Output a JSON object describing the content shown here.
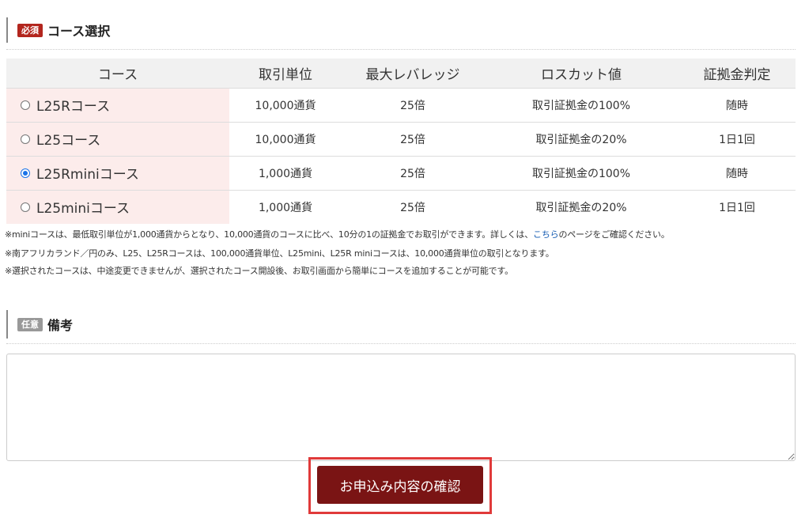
{
  "course_section": {
    "badge": "必須",
    "title": "コース選択",
    "headers": [
      "コース",
      "取引単位",
      "最大レバレッジ",
      "ロスカット値",
      "証拠金判定"
    ],
    "rows": [
      {
        "course": "L25Rコース",
        "unit": "10,000通貨",
        "leverage": "25倍",
        "losscut": "取引証拠金の100%",
        "margin_check": "随時",
        "selected": false
      },
      {
        "course": "L25コース",
        "unit": "10,000通貨",
        "leverage": "25倍",
        "losscut": "取引証拠金の20%",
        "margin_check": "1日1回",
        "selected": false
      },
      {
        "course": "L25Rminiコース",
        "unit": "1,000通貨",
        "leverage": "25倍",
        "losscut": "取引証拠金の100%",
        "margin_check": "随時",
        "selected": true
      },
      {
        "course": "L25miniコース",
        "unit": "1,000通貨",
        "leverage": "25倍",
        "losscut": "取引証拠金の20%",
        "margin_check": "1日1回",
        "selected": false
      }
    ]
  },
  "notes": {
    "line1_before": "※miniコースは、最低取引単位が1,000通貨からとなり、10,000通貨のコースに比べ、10分の1の証拠金でお取引ができます。詳しくは、",
    "line1_link": "こちら",
    "line1_after": "のページをご確認ください。",
    "line2": "※南アフリカランド／円のみ、L25、L25Rコースは、100,000通貨単位、L25mini、L25R miniコースは、10,000通貨単位の取引となります。",
    "line3": "※選択されたコースは、中途変更できませんが、選択されたコース開設後、お取引画面から簡単にコースを追加することが可能です。"
  },
  "remarks_section": {
    "badge": "任意",
    "title": "備考",
    "value": ""
  },
  "submit": {
    "label": "お申込み内容の確認"
  },
  "colors": {
    "required_badge": "#b3261e",
    "optional_badge": "#999999",
    "course_cell_bg": "#fceceb",
    "button_bg": "#7a1414",
    "highlight_border": "#e03a3a"
  }
}
